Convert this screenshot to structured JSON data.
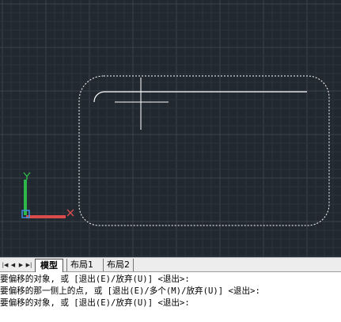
{
  "colors": {
    "canvas_bg": "#212830",
    "grid_minor": "#2c333c",
    "grid_major": "#3a424c",
    "drawing": "#ffffff",
    "ucs_y": "#2fb84a",
    "ucs_x": "#d84c4c",
    "ucs_origin": "#3a8ee0"
  },
  "ucs": {
    "y_label": "Y",
    "x_label": "X"
  },
  "tabs": {
    "nav_icons": [
      "first-tab-icon",
      "prev-tab-icon",
      "next-tab-icon",
      "last-tab-icon"
    ],
    "model": "模型",
    "layout1": "布局1",
    "layout2": "布局2"
  },
  "command_history": [
    "要偏移的对象, 或 [退出(E)/放弃(U)] <退出>:",
    "要偏移的那一侧上的点, 或 [退出(E)/多个(M)/放弃(U)] <退出>:",
    "要偏移的对象, 或 [退出(E)/放弃(U)] <退出>:"
  ]
}
